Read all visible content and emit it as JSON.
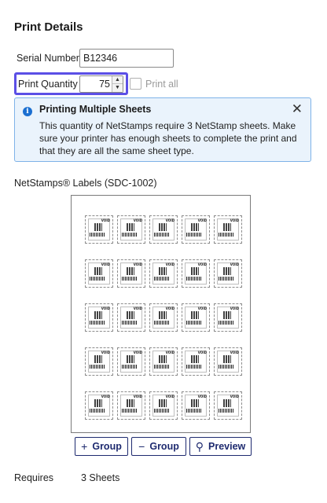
{
  "panel": {
    "title": "Print Details"
  },
  "serial": {
    "label": "Serial Number",
    "value": "B12346"
  },
  "quantity": {
    "label": "Print Quantity",
    "value": "75",
    "up_glyph": "▲",
    "down_glyph": "▼"
  },
  "print_all": {
    "label": "Print all",
    "checked": false
  },
  "alert": {
    "icon": "info-icon",
    "icon_glyph": "i",
    "title": "Printing Multiple Sheets",
    "body": "This quantity of NetStamps require 3 NetStamp sheets. Make sure your printer has enough sheets to complete the print and that they are all the same sheet type.",
    "close_glyph": "✕"
  },
  "sheet": {
    "label": "NetStamps® Labels (SDC-1002)",
    "rows": 5,
    "cols": 5,
    "stamp_void_text": "VOID"
  },
  "buttons": {
    "add_group": {
      "icon_glyph": "+",
      "label": "Group"
    },
    "remove_group": {
      "icon_glyph": "−",
      "label": "Group"
    },
    "preview": {
      "icon_glyph": "⚲",
      "label": "Preview"
    }
  },
  "requires": {
    "label": "Requires",
    "value": "3 Sheets"
  },
  "colors": {
    "focus_outline": "#5b4fe6",
    "alert_bg": "#eaf3fc",
    "alert_border": "#7fb3e8",
    "info_icon": "#1b6fd1",
    "button_text": "#1e2a6f"
  }
}
